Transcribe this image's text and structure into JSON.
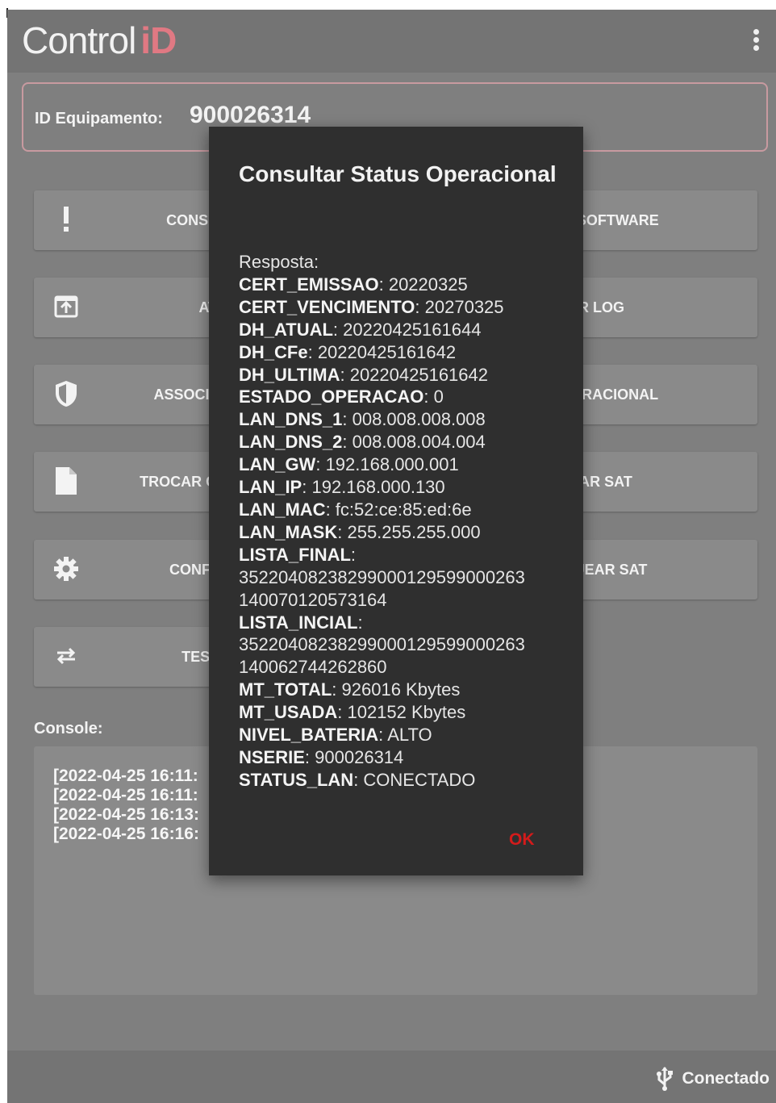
{
  "app": {
    "logo_main": "Control",
    "logo_accent": "iD"
  },
  "equipment": {
    "label": "ID Equipamento:",
    "value": "900026314"
  },
  "buttons": [
    {
      "label": "CONSULTAR STATUS",
      "icon": "exclamation-icon"
    },
    {
      "label": "ATUALIZAR SOFTWARE",
      "icon": "none"
    },
    {
      "label": "ATIVAR SAT",
      "icon": "upload-box-icon"
    },
    {
      "label": "EXTRAIR LOG",
      "icon": "none"
    },
    {
      "label": "ASSOCIAR ASSINATURA",
      "icon": "shield-icon"
    },
    {
      "label": "STATUS OPERACIONAL",
      "icon": "none"
    },
    {
      "label": "TROCAR CÓDIGO ATIVAÇÃO",
      "icon": "file-icon"
    },
    {
      "label": "BLOQUEAR SAT",
      "icon": "none"
    },
    {
      "label": "CONFIGURAR REDE",
      "icon": "gear-icon"
    },
    {
      "label": "DESBLOQUEAR SAT",
      "icon": "none"
    },
    {
      "label": "TESTE FIM A FIM",
      "icon": "swap-arrows-icon"
    }
  ],
  "console": {
    "label": "Console:",
    "lines": [
      "[2022-04-25 16:11:",
      "[2022-04-25 16:11:",
      "[2022-04-25 16:13:",
      "[2022-04-25 16:16:"
    ]
  },
  "status": {
    "text": "Conectado",
    "icon": "usb-icon"
  },
  "dialog": {
    "title": "Consultar Status Operacional",
    "response_label": "Resposta:",
    "fields": [
      {
        "key": "CERT_EMISSAO",
        "value": "20220325"
      },
      {
        "key": "CERT_VENCIMENTO",
        "value": "20270325"
      },
      {
        "key": "DH_ATUAL",
        "value": "20220425161644"
      },
      {
        "key": "DH_CFe",
        "value": "20220425161642"
      },
      {
        "key": "DH_ULTIMA",
        "value": "20220425161642"
      },
      {
        "key": "ESTADO_OPERACAO",
        "value": "0"
      },
      {
        "key": "LAN_DNS_1",
        "value": "008.008.008.008"
      },
      {
        "key": "LAN_DNS_2",
        "value": "008.008.004.004"
      },
      {
        "key": "LAN_GW",
        "value": "192.168.000.001"
      },
      {
        "key": "LAN_IP",
        "value": "192.168.000.130"
      },
      {
        "key": "LAN_MAC",
        "value": "fc:52:ce:85:ed:6e"
      },
      {
        "key": "LAN_MASK",
        "value": "255.255.255.000"
      },
      {
        "key": "LISTA_FINAL",
        "value": "35220408238299000129599000263 140070120573164"
      },
      {
        "key": "LISTA_INCIAL",
        "value": "35220408238299000129599000263 140062744262860"
      },
      {
        "key": "MT_TOTAL",
        "value": "926016 Kbytes"
      },
      {
        "key": "MT_USADA",
        "value": "102152 Kbytes"
      },
      {
        "key": "NIVEL_BATERIA",
        "value": "ALTO"
      },
      {
        "key": "NSERIE",
        "value": "900026314"
      },
      {
        "key": "STATUS_LAN",
        "value": "CONECTADO"
      }
    ],
    "ok_label": "OK"
  },
  "colors": {
    "accent": "#e07983",
    "ok": "#d31b1b",
    "dialog_bg": "#2f2f2f"
  }
}
